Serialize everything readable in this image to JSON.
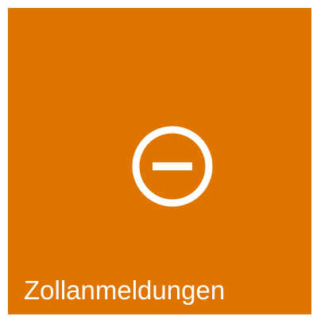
{
  "tile": {
    "label": "Zollanmeldungen",
    "icon": "minus-circle-icon",
    "background_color": "#e07400",
    "foreground_color": "#ffffff"
  }
}
